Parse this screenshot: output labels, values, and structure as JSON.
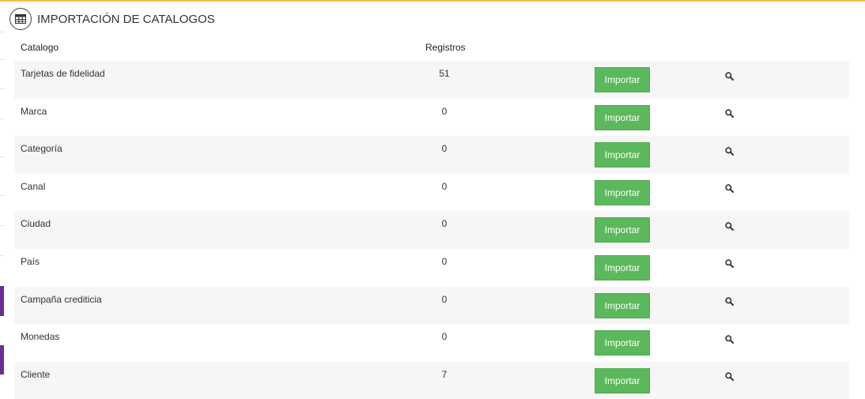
{
  "panel": {
    "title": "IMPORTACIÓN DE CATALOGOS",
    "icon": "table-icon"
  },
  "table": {
    "columns": [
      "Catalogo",
      "Registros"
    ],
    "rows": [
      {
        "name": "Tarjetas de fidelidad",
        "count": "51",
        "action": "Importar"
      },
      {
        "name": "Marca",
        "count": "0",
        "action": "Importar"
      },
      {
        "name": "Categoría",
        "count": "0",
        "action": "Importar"
      },
      {
        "name": "Canal",
        "count": "0",
        "action": "Importar"
      },
      {
        "name": "Ciudad",
        "count": "0",
        "action": "Importar"
      },
      {
        "name": "País",
        "count": "0",
        "action": "Importar"
      },
      {
        "name": "Campaña crediticia",
        "count": "0",
        "action": "Importar"
      },
      {
        "name": "Monedas",
        "count": "0",
        "action": "Importar"
      },
      {
        "name": "Cliente",
        "count": "7",
        "action": "Importar"
      }
    ],
    "row_icon": "search-icon"
  },
  "colors": {
    "top_border": "#f2c14e",
    "button_bg": "#5cb85c",
    "sidebar_accent": "#6a2c91",
    "row_stripe": "#f6f6f6"
  }
}
